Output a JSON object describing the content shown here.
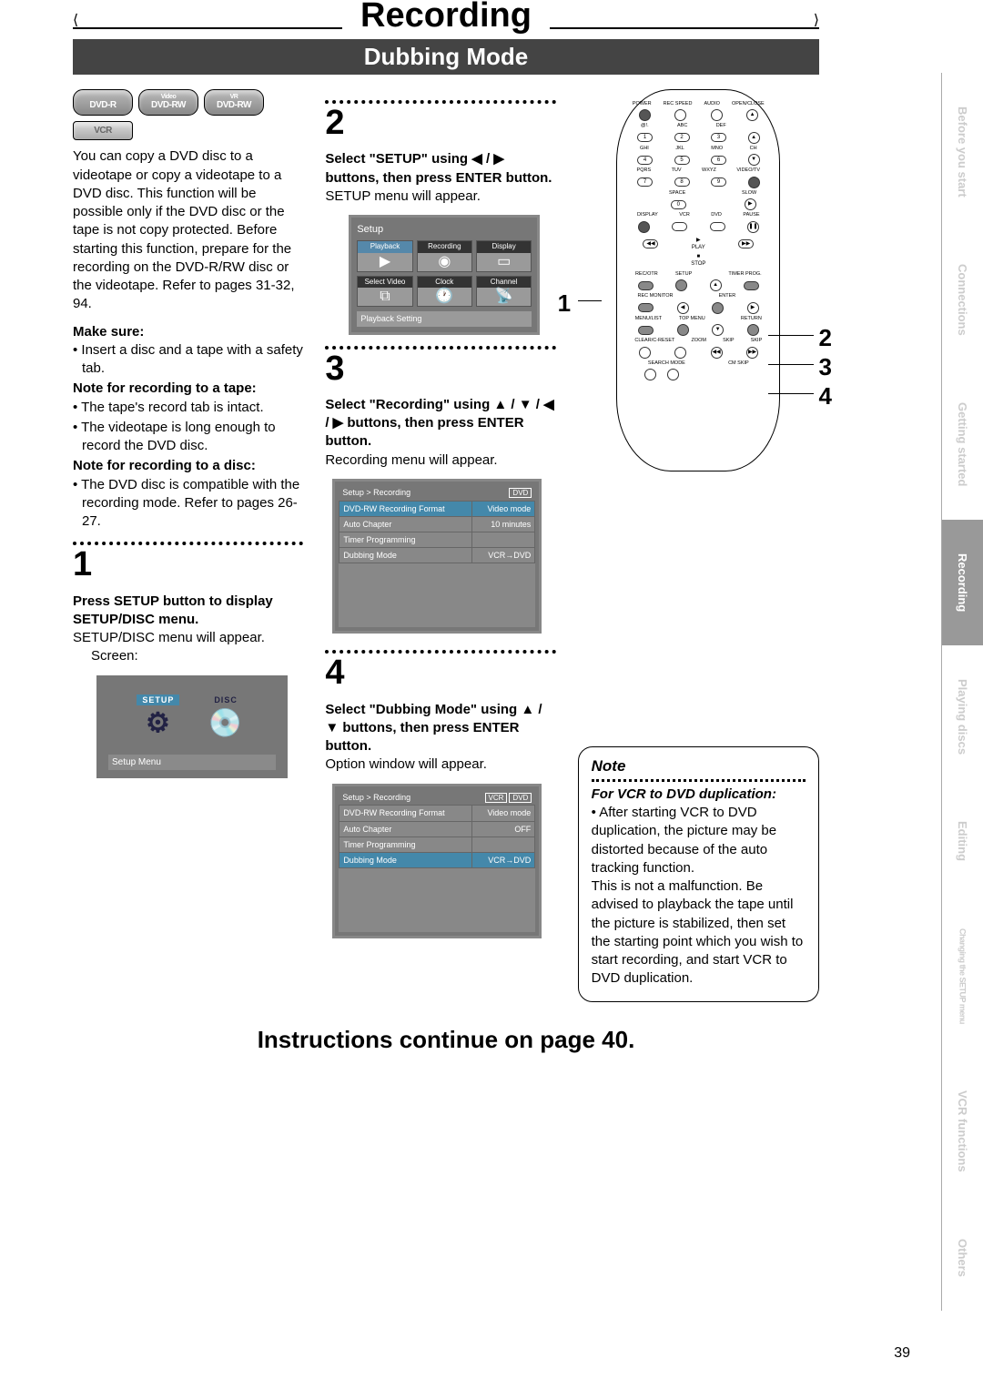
{
  "header": {
    "title": "Recording",
    "subtitle": "Dubbing Mode"
  },
  "badges": {
    "dvdr": "DVD-R",
    "dvdrw_video_sup": "Video",
    "dvdrw_video": "DVD-RW",
    "dvdrw_vr_sup": "VR",
    "dvdrw_vr": "DVD-RW",
    "vcr": "VCR"
  },
  "left_col": {
    "intro": "You can copy a DVD disc to a videotape or copy a videotape to a DVD disc. This function will be possible only if the DVD disc or the tape is not copy protected. Before starting this function, prepare for the recording on the DVD-R/RW disc or the videotape. Refer to pages 31-32, 94.",
    "make_sure_head": "Make sure:",
    "make_sure_1": "• Insert a disc and a tape with a safety tab.",
    "note_tape_head": "Note for recording to a tape:",
    "note_tape_1": "• The tape's record tab is intact.",
    "note_tape_2": "• The videotape is long enough to record the DVD disc.",
    "note_disc_head": "Note for recording to a disc:",
    "note_disc_1": "• The DVD disc is compatible with the recording mode. Refer to pages 26-27.",
    "step1_num": "1",
    "step1_head": "Press SETUP button to display SETUP/DISC menu.",
    "step1_text": "SETUP/DISC menu will appear.",
    "step1_screen": "Screen:",
    "setup_menu": {
      "setup": "SETUP",
      "disc": "DISC",
      "footer": "Setup Menu"
    }
  },
  "mid_col": {
    "step2_num": "2",
    "step2_head": "Select \"SETUP\" using ◀ / ▶ buttons, then press ENTER button.",
    "step2_text": "SETUP menu will appear.",
    "setup_grid": {
      "head": "Setup",
      "cells": [
        "Playback",
        "Recording",
        "Display",
        "Select Video",
        "Clock",
        "Channel"
      ],
      "footer": "Playback Setting"
    },
    "step3_num": "3",
    "step3_head": "Select \"Recording\" using ▲ / ▼ / ◀ / ▶ buttons, then press ENTER button.",
    "step3_text": "Recording menu will appear.",
    "rec_table1": {
      "breadcrumb": "Setup > Recording",
      "pill": "DVD",
      "rows": [
        [
          "DVD-RW Recording Format",
          "Video mode"
        ],
        [
          "Auto Chapter",
          "10 minutes"
        ],
        [
          "Timer Programming",
          ""
        ],
        [
          "Dubbing Mode",
          "VCR→DVD"
        ]
      ]
    },
    "step4_num": "4",
    "step4_head": "Select \"Dubbing Mode\" using ▲ / ▼ buttons, then press ENTER button.",
    "step4_text": "Option window will appear.",
    "rec_table2": {
      "breadcrumb": "Setup > Recording",
      "pill1": "VCR",
      "pill2": "DVD",
      "rows": [
        [
          "DVD-RW Recording Format",
          "Video mode"
        ],
        [
          "Auto Chapter",
          "OFF"
        ],
        [
          "Timer Programming",
          ""
        ],
        [
          "Dubbing Mode",
          "VCR→DVD"
        ]
      ]
    }
  },
  "right_col": {
    "indicators": {
      "i1": "1",
      "i2": "2",
      "i3": "3",
      "i4": "4"
    },
    "remote_labels": {
      "row1": [
        "POWER",
        "REC SPEED",
        "AUDIO",
        "OPEN/CLOSE"
      ],
      "row2": [
        "@!.",
        "ABC",
        "DEF",
        ""
      ],
      "nums1": [
        "1",
        "2",
        "3"
      ],
      "row3": [
        "GHI",
        "JKL",
        "MNO",
        "CH"
      ],
      "nums2": [
        "4",
        "5",
        "6"
      ],
      "row4": [
        "PQRS",
        "TUV",
        "WXYZ",
        "VIDEO/TV"
      ],
      "nums3": [
        "7",
        "8",
        "9"
      ],
      "row5l": "SPACE",
      "row5n": "0",
      "row5r": "SLOW",
      "row6": [
        "DISPLAY",
        "VCR",
        "DVD",
        "PAUSE"
      ],
      "play": "PLAY",
      "stop": "STOP",
      "row7": [
        "REC/OTR",
        "SETUP",
        "",
        "TIMER PROG."
      ],
      "rowE": "ENTER",
      "rowREC": "REC MONITOR",
      "row8": [
        "MENU/LIST",
        "TOP MENU",
        "",
        "RETURN"
      ],
      "row9": [
        "CLEAR/C-RESET",
        "ZOOM",
        "SKIP",
        "SKIP"
      ],
      "row10": [
        "SEARCH MODE",
        "CM SKIP"
      ]
    },
    "note": {
      "head": "Note",
      "subhead": "For VCR to DVD duplication:",
      "bullet": "• After starting VCR to DVD duplication, the picture may be distorted because of the auto tracking function.\nThis is not a malfunction. Be advised to playback the tape until the picture is stabilized, then set the starting point which you wish to start recording, and start VCR to DVD duplication."
    }
  },
  "continue": "Instructions continue on page 40.",
  "page_number": "39",
  "sidetabs": [
    {
      "label": "Before you start",
      "active": false
    },
    {
      "label": "Connections",
      "active": false
    },
    {
      "label": "Getting started",
      "active": false
    },
    {
      "label": "Recording",
      "active": true
    },
    {
      "label": "Playing discs",
      "active": false
    },
    {
      "label": "Editing",
      "active": false
    },
    {
      "label": "Changing the SETUP menu",
      "active": false,
      "small": true
    },
    {
      "label": "VCR functions",
      "active": false
    },
    {
      "label": "Others",
      "active": false
    }
  ]
}
